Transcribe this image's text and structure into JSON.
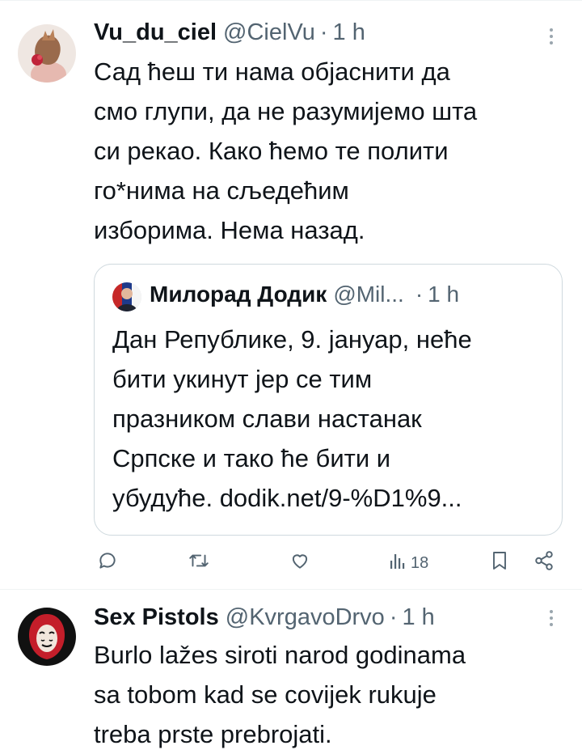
{
  "tweets": [
    {
      "name": "Vu_du_ciel",
      "handle": "@CielVu",
      "separator": "·",
      "time": "1 h",
      "lines": [
        "Сад ћеш ти нама објаснити да",
        "смо глупи, да не разумијемо шта",
        "си рекао. Како ћемо те полити",
        "го*нима на сљедећим",
        "изборима. Нема назад."
      ],
      "quote": {
        "name": "Милорад Додик",
        "handle": "@Mil...",
        "separator": "·",
        "time": "1 h",
        "lines": [
          "Дан Републике, 9. јануар, неће",
          "бити укинут јер се тим",
          "празником слави настанак",
          "Српске и тако ће бити и",
          "убудуће. dodik.net/9-%D1%9..."
        ]
      },
      "actions": {
        "reply_icon": "reply-icon",
        "retweet_icon": "retweet-icon",
        "like_icon": "like-icon",
        "views_icon": "views-icon",
        "views_count": "18",
        "bookmark_icon": "bookmark-icon",
        "share_icon": "share-icon"
      }
    },
    {
      "name": "Sex Pistols",
      "handle": "@KvrgavoDrvo",
      "separator": "·",
      "time": "1 h",
      "lines": [
        "Burlo lažes siroti narod godinama",
        "sa tobom kad se covijek rukuje",
        "treba prste prebrojati."
      ]
    }
  ],
  "colors": {
    "text": "#0f1419",
    "muted": "#536471",
    "border": "#cfd9de"
  }
}
